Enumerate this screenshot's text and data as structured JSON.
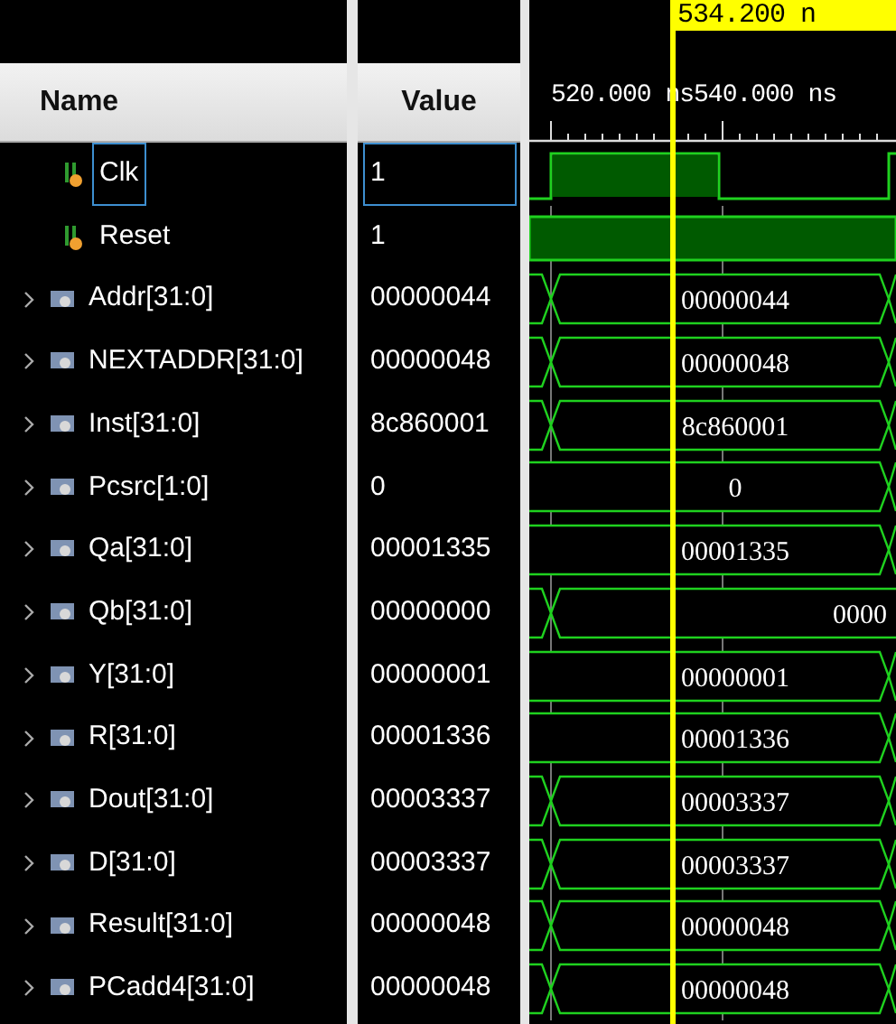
{
  "columns": {
    "name": "Name",
    "value": "Value"
  },
  "cursor": {
    "label": "534.200 n"
  },
  "ruler": {
    "labels": [
      "520.000 ns",
      "540.000 ns"
    ]
  },
  "signals": [
    {
      "name": "Clk",
      "value": "1",
      "kind": "bit",
      "selected": true,
      "wave": {
        "kind": "clock"
      }
    },
    {
      "name": "Reset",
      "value": "1",
      "kind": "bit",
      "selected": false,
      "wave": {
        "kind": "high"
      }
    },
    {
      "name": "Addr[31:0]",
      "value": "00000044",
      "kind": "bus",
      "selected": false,
      "wave": {
        "kind": "bus",
        "label": "00000044",
        "transition_left": true,
        "transition_right": true
      }
    },
    {
      "name": "NEXTADDR[31:0]",
      "value": "00000048",
      "kind": "bus",
      "selected": false,
      "wave": {
        "kind": "bus",
        "label": "00000048",
        "transition_left": true,
        "transition_right": true
      }
    },
    {
      "name": "Inst[31:0]",
      "value": "8c860001",
      "kind": "bus",
      "selected": false,
      "wave": {
        "kind": "bus",
        "label": "8c860001",
        "transition_left": true,
        "transition_right": true
      }
    },
    {
      "name": "Pcsrc[1:0]",
      "value": "0",
      "kind": "bus",
      "selected": false,
      "wave": {
        "kind": "bus",
        "label": "0",
        "transition_left": false,
        "transition_right": true
      }
    },
    {
      "name": "Qa[31:0]",
      "value": "00001335",
      "kind": "bus",
      "selected": false,
      "wave": {
        "kind": "bus",
        "label": "00001335",
        "transition_left": false,
        "transition_right": true
      }
    },
    {
      "name": "Qb[31:0]",
      "value": "00000000",
      "kind": "bus",
      "selected": false,
      "wave": {
        "kind": "bus",
        "label": "0000",
        "transition_left": true,
        "transition_right": false
      }
    },
    {
      "name": "Y[31:0]",
      "value": "00000001",
      "kind": "bus",
      "selected": false,
      "wave": {
        "kind": "bus",
        "label": "00000001",
        "transition_left": false,
        "transition_right": true
      }
    },
    {
      "name": "R[31:0]",
      "value": "00001336",
      "kind": "bus",
      "selected": false,
      "wave": {
        "kind": "bus",
        "label": "00001336",
        "transition_left": false,
        "transition_right": true
      }
    },
    {
      "name": "Dout[31:0]",
      "value": "00003337",
      "kind": "bus",
      "selected": false,
      "wave": {
        "kind": "bus",
        "label": "00003337",
        "transition_left": true,
        "transition_right": true
      }
    },
    {
      "name": "D[31:0]",
      "value": "00003337",
      "kind": "bus",
      "selected": false,
      "wave": {
        "kind": "bus",
        "label": "00003337",
        "transition_left": true,
        "transition_right": true
      }
    },
    {
      "name": "Result[31:0]",
      "value": "00000048",
      "kind": "bus",
      "selected": false,
      "wave": {
        "kind": "bus",
        "label": "00000048",
        "transition_left": true,
        "transition_right": true
      }
    },
    {
      "name": "PCadd4[31:0]",
      "value": "00000048",
      "kind": "bus",
      "selected": false,
      "wave": {
        "kind": "bus",
        "label": "00000048",
        "transition_left": true,
        "transition_right": true
      }
    }
  ]
}
